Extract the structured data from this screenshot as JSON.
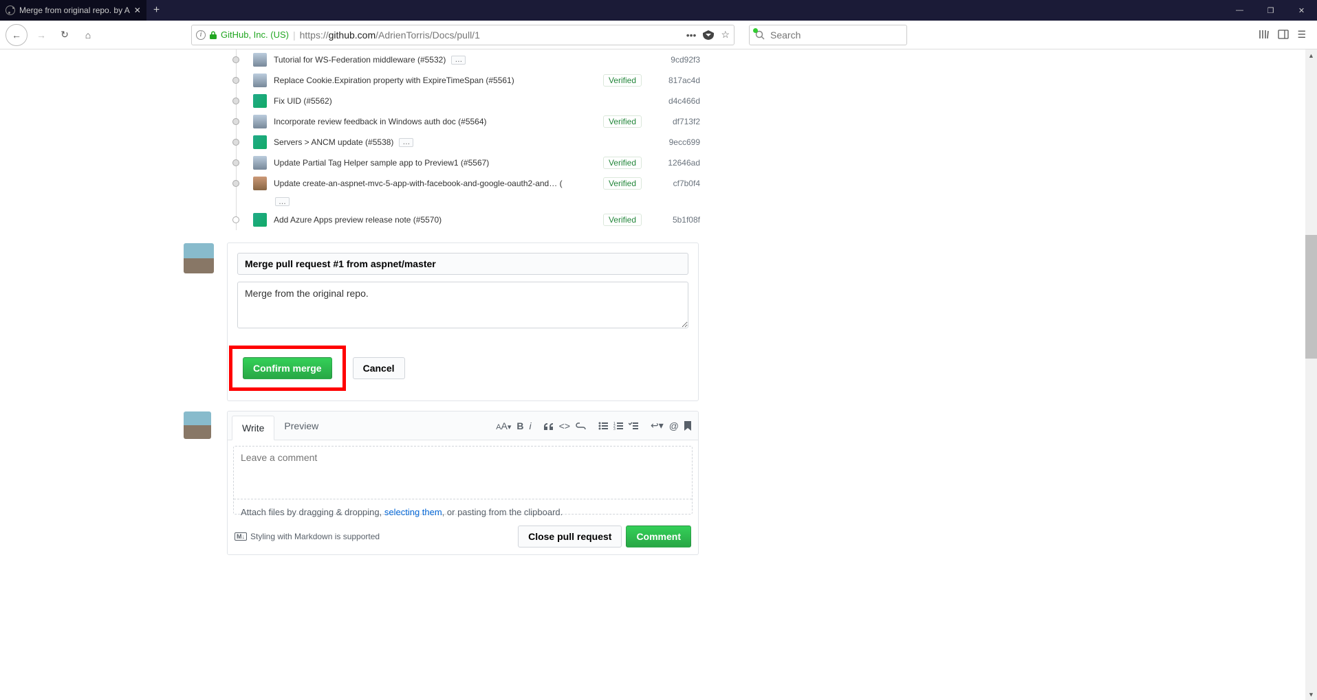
{
  "browser": {
    "tab_title": "Merge from original repo. by A",
    "url_prefix": "https://",
    "url_host": "github.com",
    "url_path": "/AdrienTorris/Docs/pull/1",
    "secure_label": "GitHub, Inc. (US)",
    "search_placeholder": "Search"
  },
  "commits": [
    {
      "msg": "Tutorial for WS-Federation middleware (#5532)",
      "av": "user",
      "verified": false,
      "sha": "9cd92f3",
      "ell": true
    },
    {
      "msg": "Replace Cookie.Expiration property with ExpireTimeSpan (#5561)",
      "av": "user",
      "verified": true,
      "sha": "817ac4d",
      "ell": false
    },
    {
      "msg": "Fix UID (#5562)",
      "av": "dino",
      "verified": false,
      "sha": "d4c466d",
      "ell": false
    },
    {
      "msg": "Incorporate review feedback in Windows auth doc (#5564)",
      "av": "user",
      "verified": true,
      "sha": "df713f2",
      "ell": false
    },
    {
      "msg": "Servers > ANCM update (#5538)",
      "av": "dino",
      "verified": false,
      "sha": "9ecc699",
      "ell": true
    },
    {
      "msg": "Update Partial Tag Helper sample app to Preview1 (#5567)",
      "av": "user",
      "verified": true,
      "sha": "12646ad",
      "ell": false
    },
    {
      "msg": "Update create-an-aspnet-mvc-5-app-with-facebook-and-google-oauth2-and… (",
      "av": "user2",
      "verified": true,
      "sha": "cf7b0f4",
      "ell": false,
      "ellBelow": true
    },
    {
      "msg": "Add Azure Apps preview release note (#5570)",
      "av": "dino",
      "verified": true,
      "sha": "5b1f08f",
      "ell": false,
      "dotOpen": true
    }
  ],
  "merge": {
    "title": "Merge pull request #1 from aspnet/master",
    "body": "Merge from the original repo.",
    "confirm": "Confirm merge",
    "cancel": "Cancel"
  },
  "comment": {
    "tabs": {
      "write": "Write",
      "preview": "Preview"
    },
    "placeholder": "Leave a comment",
    "attach_pre": "Attach files by dragging & dropping, ",
    "attach_link": "selecting them",
    "attach_post": ", or pasting from the clipboard.",
    "md_hint": "Styling with Markdown is supported",
    "close": "Close pull request",
    "submit": "Comment"
  }
}
